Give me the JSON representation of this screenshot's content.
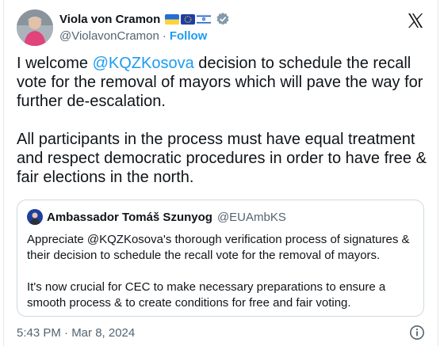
{
  "author": {
    "display_name": "Viola von Cramon",
    "handle": "@ViolavonCramon",
    "separator": "·",
    "follow_label": "Follow",
    "flags": [
      "ukraine-flag",
      "eu-flag",
      "israel-flag"
    ],
    "verified_icon": "verified-badge-icon"
  },
  "logo": "x-logo-icon",
  "tweet": {
    "mention": "@KQZKosova",
    "text_before": "I welcome ",
    "text_after": " decision to schedule the recall vote for the removal of mayors which will pave the way for further de-escalation.\n\nAll participants in the process must have equal treatment and respect democratic procedures in order to have free & fair elections in the north."
  },
  "quote": {
    "display_name": "Ambassador Tomáš Szunyog",
    "handle": "@EUAmbKS",
    "text": "Appreciate @KQZKosova's thorough verification process of signatures & their decision to schedule the recall vote for the removal of mayors.\n\nIt's now crucial for CEC to make necessary preparations to ensure a smooth process & to create conditions for free and fair voting."
  },
  "footer": {
    "timestamp": "5:43 PM · Mar 8, 2024",
    "info_icon": "info-icon"
  },
  "colors": {
    "accent": "#1d9bf0",
    "text": "#0f1419",
    "muted": "#536471",
    "border": "#cfd9de"
  }
}
